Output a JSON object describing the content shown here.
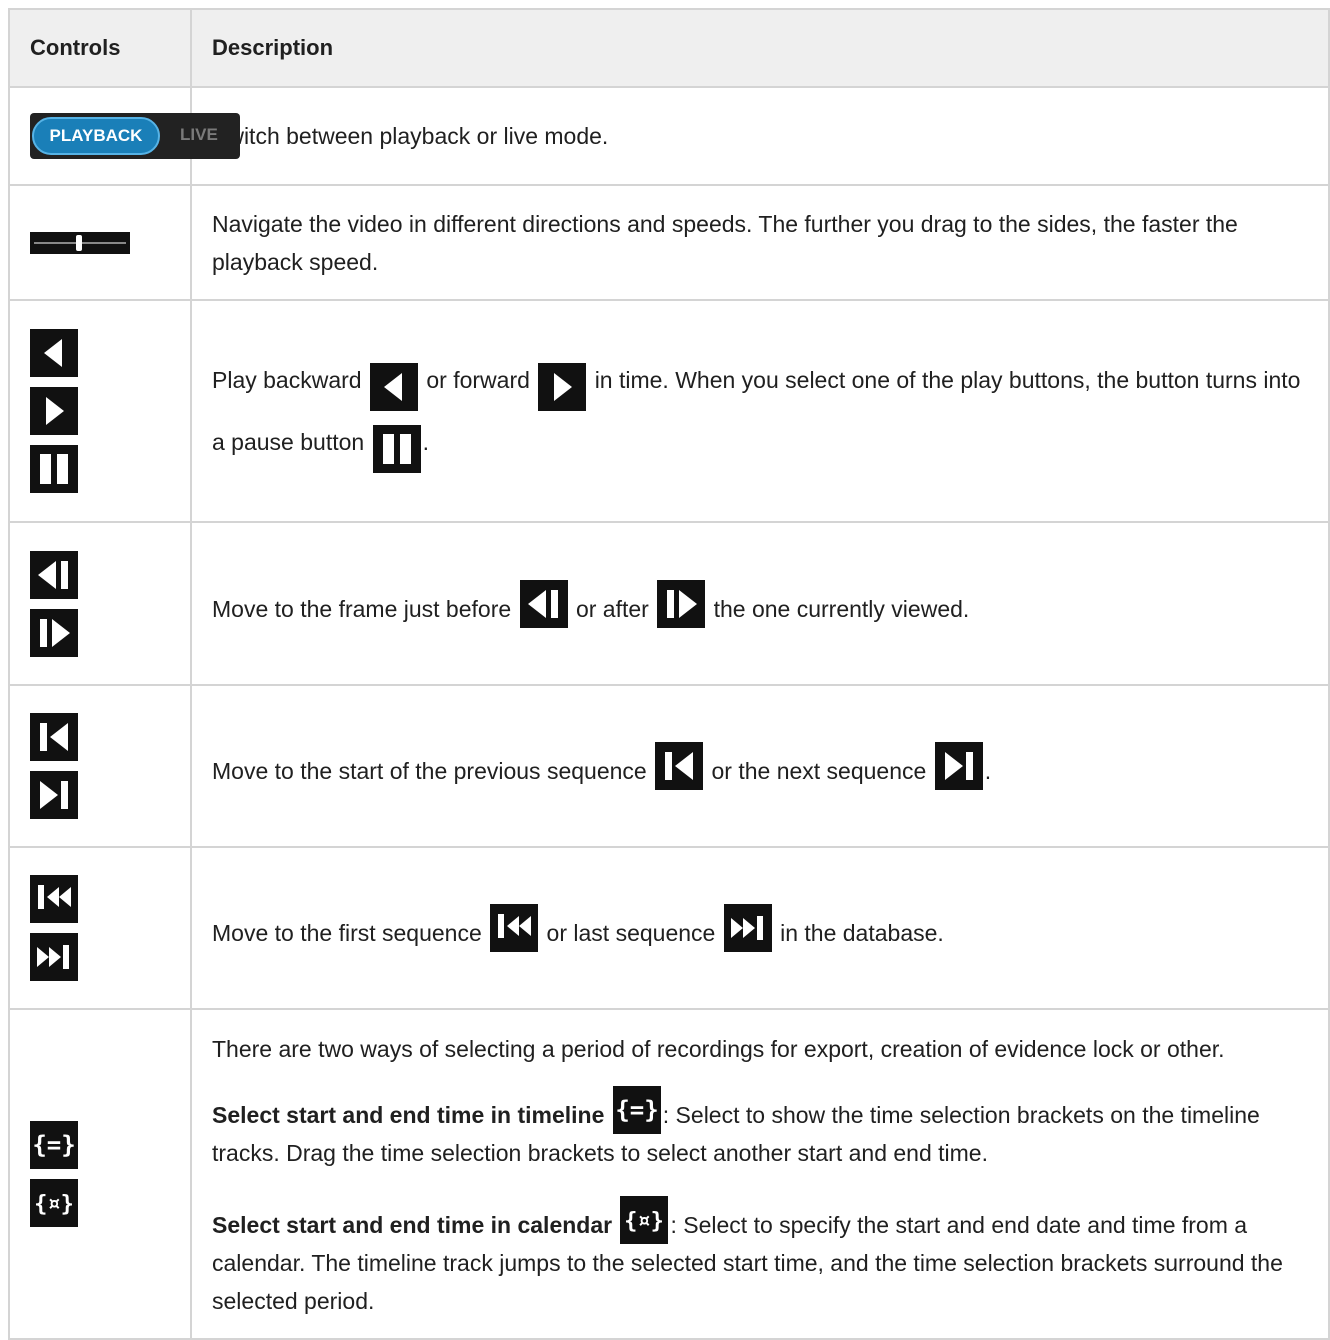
{
  "table": {
    "headers": {
      "controls": "Controls",
      "description": "Description"
    },
    "rows": {
      "mode": {
        "toggle_playback": "PLAYBACK",
        "toggle_live": "LIVE",
        "text": "Switch between playback or live mode."
      },
      "jog": {
        "text": "Navigate the video in different directions and speeds. The further you drag to the sides, the faster the playback speed."
      },
      "play": {
        "t1": "Play backward",
        "t2": "or forward",
        "t3": "in time. When you select one of the play buttons, the button turns into a pause button",
        "t4": "."
      },
      "frame": {
        "t1": "Move to the frame just before",
        "t2": "or after",
        "t3": "the one currently viewed."
      },
      "sequence": {
        "t1": "Move to the start of the previous sequence",
        "t2": "or the next sequence",
        "t3": "."
      },
      "database": {
        "t1": "Move to the first sequence",
        "t2": "or last sequence",
        "t3": "in the database."
      },
      "selection": {
        "intro": "There are two ways of selecting a period of recordings for export, creation of evidence lock or other.",
        "timeline_bold": "Select start and end time in timeline",
        "timeline_text": ": Select to show the time selection brackets on the timeline tracks. Drag the time selection brackets to select another start and end time.",
        "calendar_bold": "Select start and end time in calendar",
        "calendar_text": ": Select to specify the start and end date and time from a calendar. The timeline track jumps to the selected start time, and the time selection brackets surround the selected period."
      }
    }
  },
  "icons": [
    "play-backward-icon",
    "play-forward-icon",
    "pause-icon",
    "previous-frame-icon",
    "next-frame-icon",
    "previous-sequence-icon",
    "next-sequence-icon",
    "first-sequence-icon",
    "last-sequence-icon",
    "timeline-selection-icon",
    "calendar-selection-icon"
  ]
}
